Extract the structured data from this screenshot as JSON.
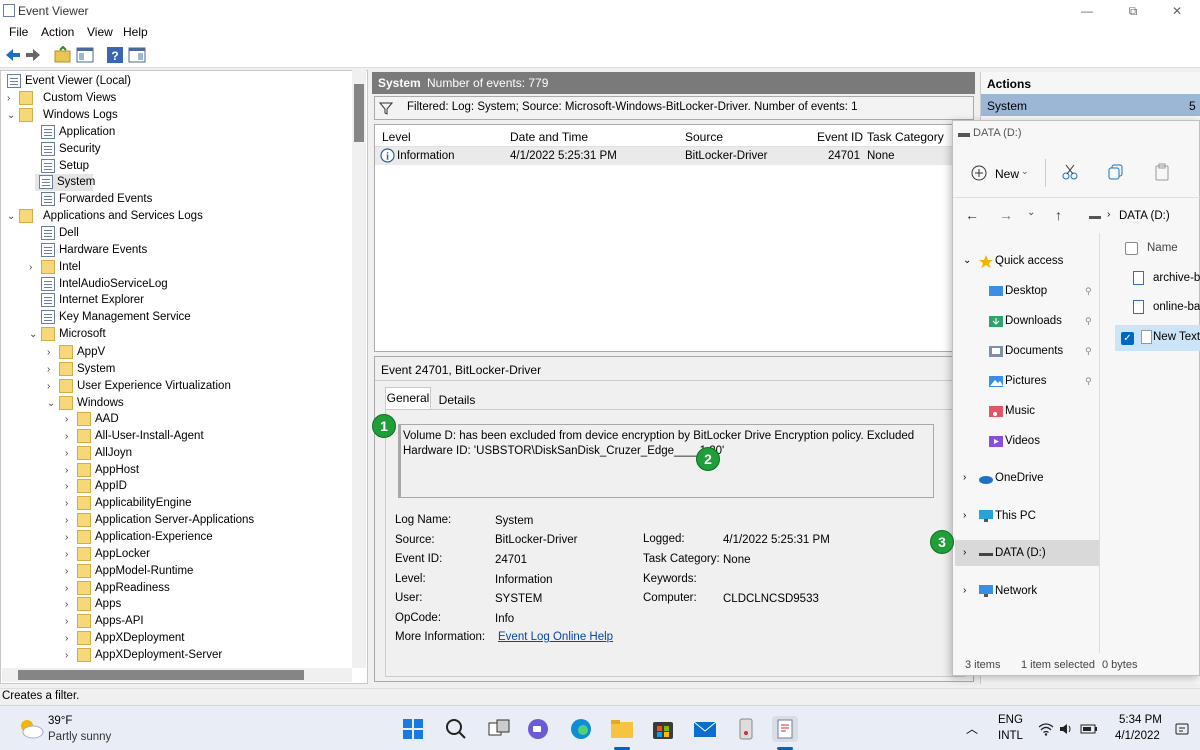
{
  "window": {
    "title": "Event Viewer",
    "controls": {
      "minimize": "—",
      "restore": "⧉",
      "close": "✕"
    }
  },
  "menu": [
    "File",
    "Action",
    "View",
    "Help"
  ],
  "tree": {
    "root": "Event Viewer (Local)",
    "custom_views": "Custom Views",
    "windows_logs": "Windows Logs",
    "windows_logs_items": [
      "Application",
      "Security",
      "Setup",
      "System",
      "Forwarded Events"
    ],
    "app_services": "Applications and Services Logs",
    "app_services_items": [
      "Dell",
      "Hardware Events",
      "Intel",
      "IntelAudioServiceLog",
      "Internet Explorer",
      "Key Management Service",
      "Microsoft"
    ],
    "microsoft_items": [
      "AppV",
      "System",
      "User Experience Virtualization",
      "Windows"
    ],
    "windows_items": [
      "AAD",
      "All-User-Install-Agent",
      "AllJoyn",
      "AppHost",
      "AppID",
      "ApplicabilityEngine",
      "Application Server-Applications",
      "Application-Experience",
      "AppLocker",
      "AppModel-Runtime",
      "AppReadiness",
      "Apps",
      "Apps-API",
      "AppXDeployment",
      "AppXDeployment-Server"
    ]
  },
  "middle": {
    "header_title": "System",
    "header_count": "Number of events: 779",
    "filter_text": "Filtered: Log: System; Source: Microsoft-Windows-BitLocker-Driver. Number of events: 1",
    "columns": [
      "Level",
      "Date and Time",
      "Source",
      "Event ID",
      "Task Category"
    ],
    "row": {
      "level": "Information",
      "datetime": "4/1/2022 5:25:31 PM",
      "source": "BitLocker-Driver",
      "event_id": "24701",
      "category": "None"
    }
  },
  "detail": {
    "title": "Event 24701, BitLocker-Driver",
    "tabs": [
      "General",
      "Details"
    ],
    "message": "Volume D: has been excluded from device encryption by BitLocker Drive Encryption policy. Excluded Hardware ID: 'USBSTOR\\DiskSanDisk_Cruzer_Edge____1.20'",
    "labels": {
      "log_name": "Log Name:",
      "source": "Source:",
      "event_id": "Event ID:",
      "level": "Level:",
      "user": "User:",
      "opcode": "OpCode:",
      "more_info": "More Information:",
      "logged": "Logged:",
      "task_category": "Task Category:",
      "keywords": "Keywords:",
      "computer": "Computer:"
    },
    "values": {
      "log_name": "System",
      "source": "BitLocker-Driver",
      "event_id": "24701",
      "level": "Information",
      "user": "SYSTEM",
      "opcode": "Info",
      "more_info": "Event Log Online Help",
      "logged": "4/1/2022 5:25:31 PM",
      "task_category": "None",
      "keywords": "",
      "computer": "CLDCLNCSD9533"
    }
  },
  "actions": {
    "title": "Actions",
    "selected": "System",
    "count": "5"
  },
  "explorer": {
    "title": "DATA (D:)",
    "new_label": "New",
    "address": "DATA (D:)",
    "column_name": "Name",
    "files": [
      "archive-ba",
      "online-ba",
      "New Text"
    ],
    "nav": {
      "quick_access": "Quick access",
      "desktop": "Desktop",
      "downloads": "Downloads",
      "documents": "Documents",
      "pictures": "Pictures",
      "music": "Music",
      "videos": "Videos",
      "onedrive": "OneDrive",
      "this_pc": "This PC",
      "data": "DATA (D:)",
      "network": "Network"
    },
    "status": {
      "items": "3 items",
      "selected": "1 item selected",
      "size": "0 bytes"
    }
  },
  "badges": [
    "1",
    "2",
    "3"
  ],
  "status_bar": "Creates a filter.",
  "taskbar": {
    "temp": "39°F",
    "weather": "Partly sunny",
    "lang1": "ENG",
    "lang2": "INTL",
    "time": "5:34 PM",
    "date": "4/1/2022"
  },
  "colors": {
    "accent": "#0067c0",
    "badge": "#1f9e3a",
    "header": "#7a7a7a",
    "actions_sel": "#9cb6d6"
  }
}
